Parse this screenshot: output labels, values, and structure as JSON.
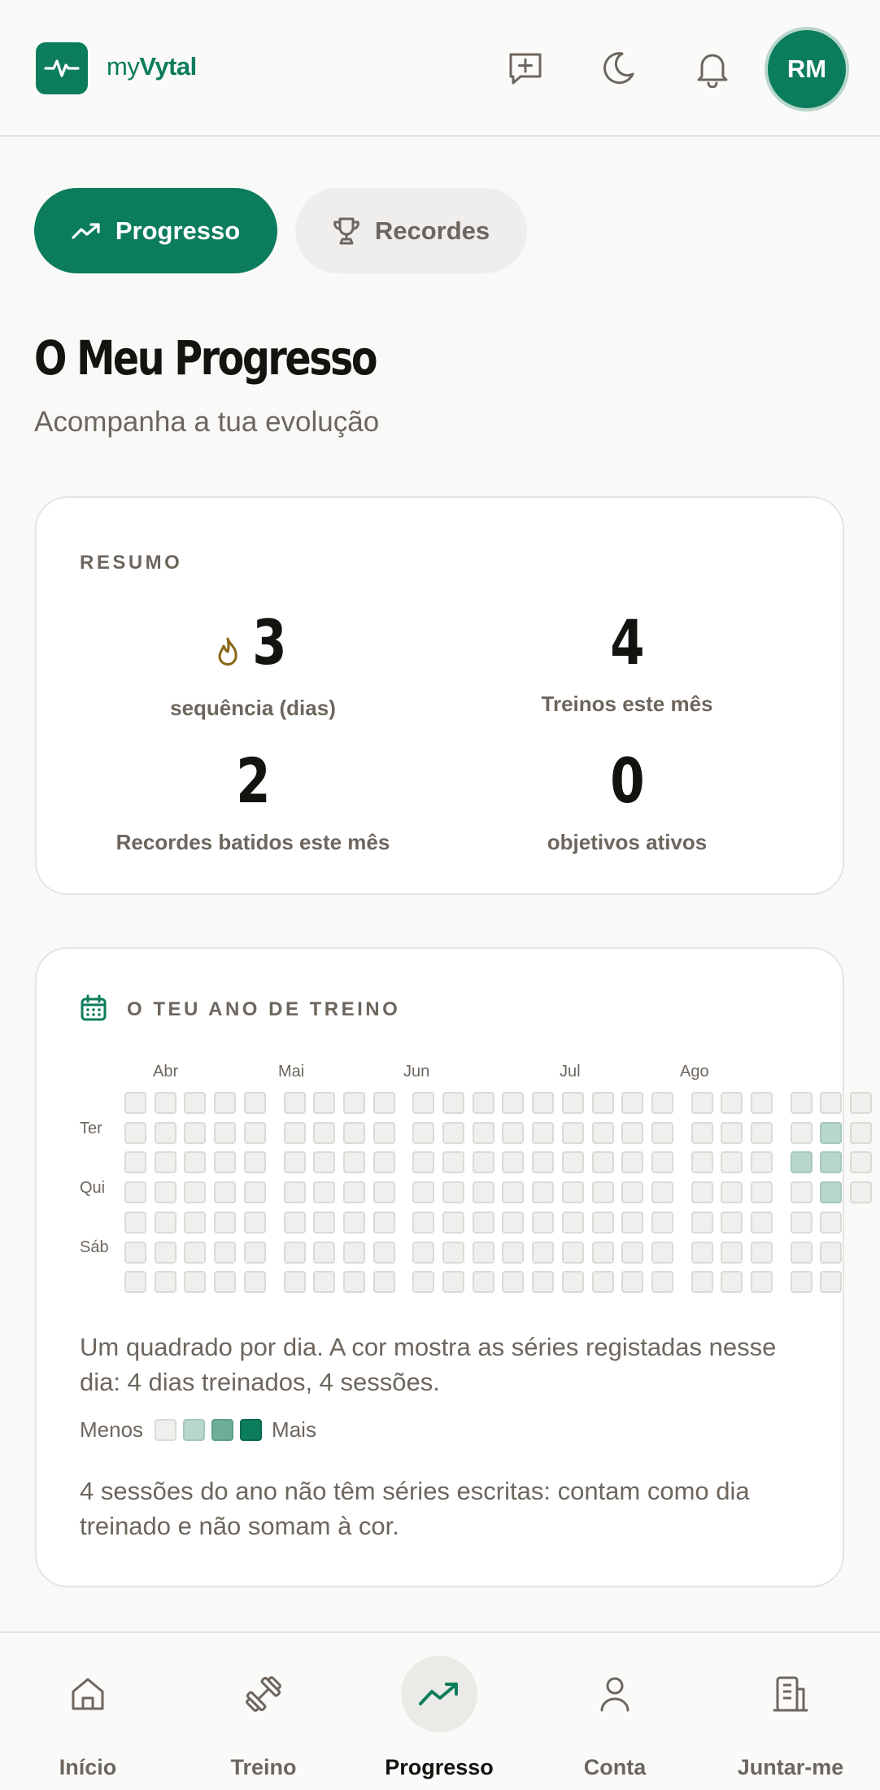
{
  "header": {
    "brand_prefix": "my",
    "brand_name": "Vytal",
    "avatar_initials": "RM",
    "icons": [
      "message-plus-icon",
      "moon-icon",
      "bell-icon"
    ]
  },
  "tabs": [
    {
      "label": "Progresso",
      "active": true,
      "icon": "trending-up-icon"
    },
    {
      "label": "Recordes",
      "active": false,
      "icon": "trophy-icon"
    }
  ],
  "page": {
    "title": "O Meu Progresso",
    "subtitle": "Acompanha a tua evolução"
  },
  "summary": {
    "label": "RESUMO",
    "stats": [
      {
        "value": "3",
        "label": "sequência (dias)",
        "icon": "flame-icon"
      },
      {
        "value": "4",
        "label": "Treinos este mês"
      },
      {
        "value": "2",
        "label": "Recordes batidos este mês"
      },
      {
        "value": "0",
        "label": "objetivos ativos"
      }
    ]
  },
  "year": {
    "label": "O TEU ANO DE TREINO",
    "months": [
      "Abr",
      "Mai",
      "Jun",
      "Jul",
      "Ago"
    ],
    "days": [
      "Ter",
      "Qui",
      "Sáb"
    ],
    "week_groups": [
      5,
      4,
      9,
      3
    ],
    "last_week_days": 4,
    "active_cells": [
      {
        "week": 21,
        "day": 2,
        "level": 1
      },
      {
        "week": 22,
        "day": 1,
        "level": 1
      },
      {
        "week": 22,
        "day": 2,
        "level": 1
      },
      {
        "week": 22,
        "day": 3,
        "level": 1
      }
    ],
    "description": "Um quadrado por dia. A cor mostra as séries registadas nesse dia: 4 dias treinados, 4 sessões.",
    "legend_less": "Menos",
    "legend_more": "Mais",
    "note": "4 sessões do ano não têm séries escritas: contam como dia treinado e não somam à cor."
  },
  "nav": [
    {
      "label": "Início",
      "icon": "home-icon",
      "active": false
    },
    {
      "label": "Treino",
      "icon": "dumbbell-icon",
      "active": false
    },
    {
      "label": "Progresso",
      "icon": "trending-up-icon",
      "active": true
    },
    {
      "label": "Conta",
      "icon": "user-icon",
      "active": false
    },
    {
      "label": "Juntar-me",
      "icon": "building-icon",
      "active": false
    }
  ],
  "colors": {
    "accent": "#0c7d5c",
    "muted_text": "#6d665e",
    "flame": "#8a6410"
  }
}
